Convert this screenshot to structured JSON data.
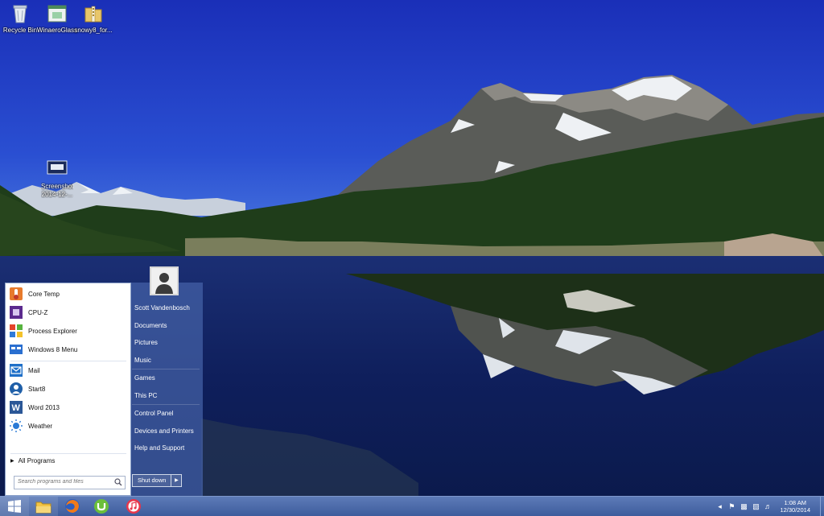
{
  "desktop": {
    "icons": [
      {
        "label": "Recycle Bin"
      },
      {
        "label": "WinaeroGlass"
      },
      {
        "label": "snowy8_for..."
      },
      {
        "label": "Screenshot 2014-12-..."
      }
    ]
  },
  "start_menu": {
    "programs": [
      {
        "label": "Core Temp",
        "icon": "core-temp-icon"
      },
      {
        "label": "CPU-Z",
        "icon": "cpu-z-icon"
      },
      {
        "label": "Process Explorer",
        "icon": "process-explorer-icon"
      },
      {
        "label": "Windows 8 Menu",
        "icon": "windows8-menu-icon"
      },
      {
        "label": "Mail",
        "icon": "mail-icon"
      },
      {
        "label": "Start8",
        "icon": "start8-icon"
      },
      {
        "label": "Word 2013",
        "icon": "word-icon"
      },
      {
        "label": "Weather",
        "icon": "weather-icon"
      }
    ],
    "all_programs": "All Programs",
    "search_placeholder": "Search programs and files",
    "user_name": "Scott Vandenbosch",
    "places": [
      "Documents",
      "Pictures",
      "Music",
      "Games",
      "This PC",
      "Control Panel",
      "Devices and Printers",
      "Help and Support"
    ],
    "shutdown_label": "Shut down"
  },
  "taskbar": {
    "apps": [
      "start-button",
      "file-explorer-icon",
      "firefox-icon",
      "utorrent-icon",
      "itunes-icon"
    ],
    "clock_time": "1:08 AM",
    "clock_date": "12/30/2014"
  },
  "colors": {
    "accent": "#4a6aac",
    "taskbar": "#4a68a8",
    "sky": "#1f3fc0"
  }
}
